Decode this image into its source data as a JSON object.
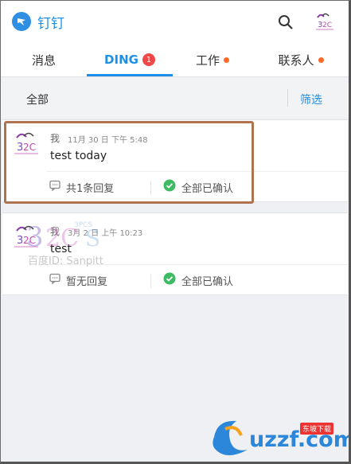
{
  "app": {
    "title": "钉钉",
    "accent": "#1f8fe6"
  },
  "tabs": [
    {
      "label": "消息"
    },
    {
      "label": "DING",
      "badge": "1",
      "active": true
    },
    {
      "label": "工作",
      "dot": true
    },
    {
      "label": "联系人",
      "dot": true
    }
  ],
  "filter": {
    "scope_label": "全部",
    "filter_label": "筛选"
  },
  "dings": [
    {
      "sender": "我",
      "time": "11月 30 日 下午 5:48",
      "message": "test today",
      "reply_label": "共1条回复",
      "status_label": "全部已确认"
    },
    {
      "sender": "我",
      "time": "3月 2 日 上午 10:23",
      "message": "test",
      "reply_label": "暂无回复",
      "status_label": "全部已确认"
    }
  ],
  "watermark": {
    "text": "百度ID: Sanpitt"
  },
  "site_badge": {
    "text": "uzzf.com",
    "tag": "东坡下载"
  },
  "colors": {
    "confirm_green": "#3dbb63",
    "badge_red": "#f04848",
    "dot_orange": "#ff6a2a",
    "highlight_border": "#b0734f"
  }
}
